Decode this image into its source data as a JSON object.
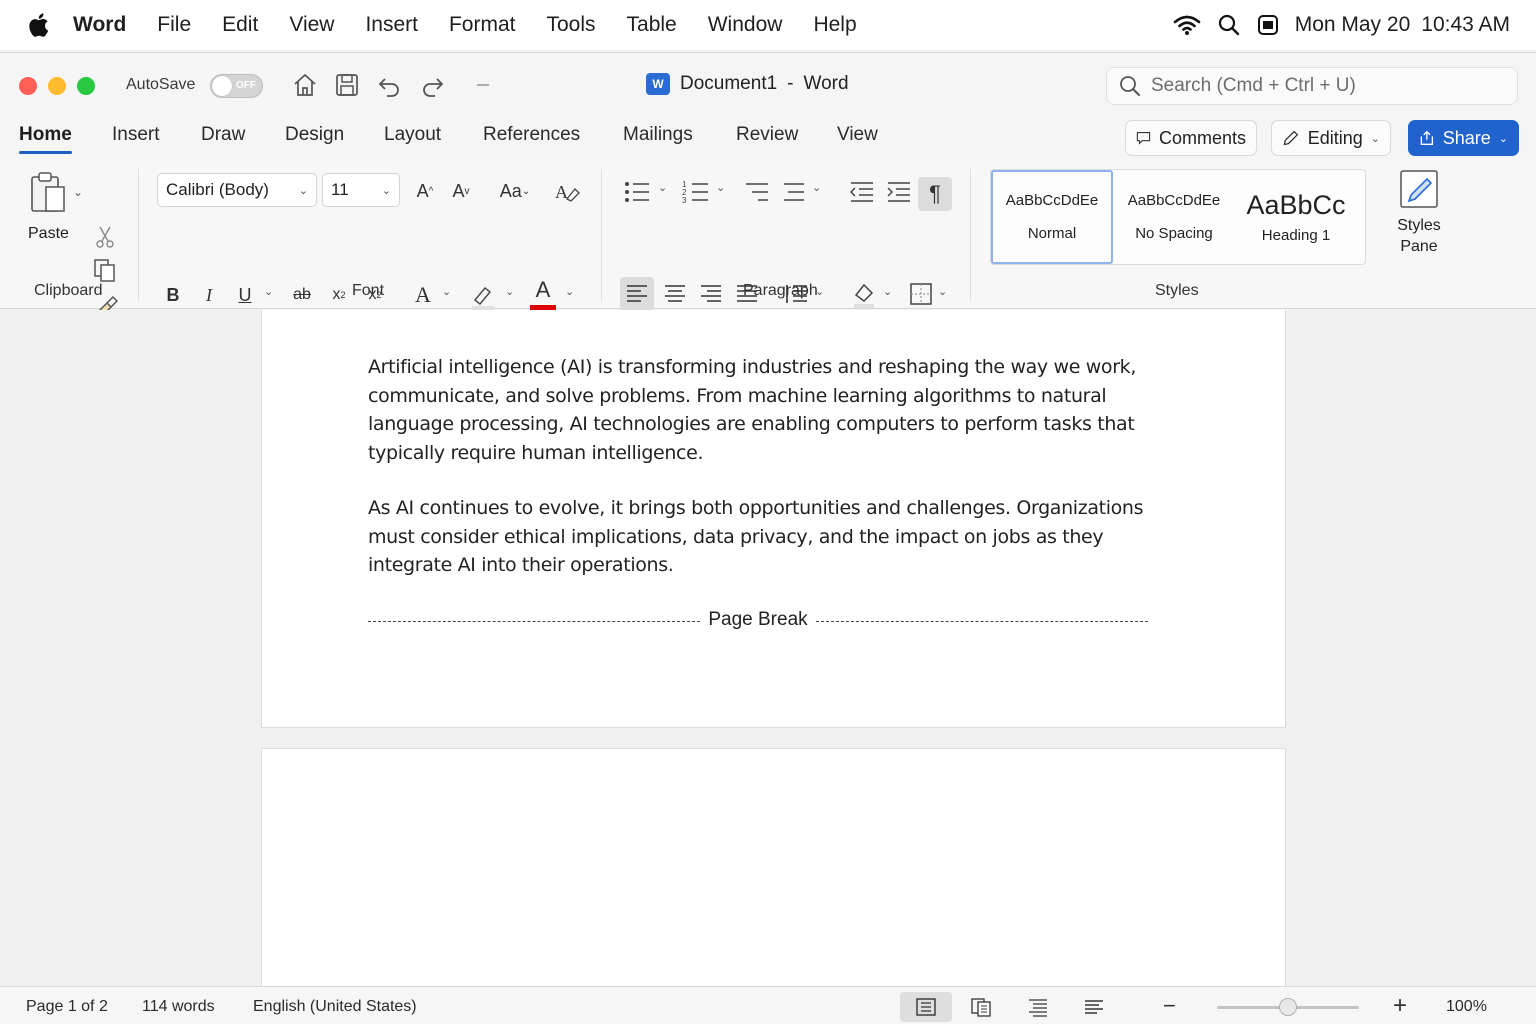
{
  "menubar": {
    "app": "Word",
    "items": [
      "File",
      "Edit",
      "View",
      "Insert",
      "Format",
      "Tools",
      "Table",
      "Window",
      "Help"
    ],
    "date": "Mon May 20",
    "time": "10:43 AM"
  },
  "titlebar": {
    "autosave_label": "AutoSave",
    "autosave_state": "OFF",
    "doc_name": "Document1",
    "separator": "-",
    "app_name": "Word",
    "app_badge": "W",
    "search_placeholder": "Search (Cmd + Ctrl + U)"
  },
  "tabs": {
    "items": [
      "Home",
      "Insert",
      "Draw",
      "Design",
      "Layout",
      "References",
      "Mailings",
      "Review",
      "View"
    ],
    "active": "Home",
    "comments": "Comments",
    "editing": "Editing",
    "share": "Share"
  },
  "ribbon": {
    "clipboard": {
      "paste": "Paste",
      "label": "Clipboard"
    },
    "font": {
      "name": "Calibri (Body)",
      "size": "11",
      "label": "Font",
      "font_color": "#e00000"
    },
    "paragraph": {
      "label": "Paragraph"
    },
    "styles": {
      "label": "Styles",
      "items": [
        {
          "sample": "AaBbCcDdEe",
          "name": "Normal"
        },
        {
          "sample": "AaBbCcDdEe",
          "name": "No Spacing"
        },
        {
          "sample": "AaBbCc",
          "name": "Heading 1"
        }
      ],
      "pane_line1": "Styles",
      "pane_line2": "Pane"
    }
  },
  "document": {
    "paragraphs": [
      "Artificial intelligence (AI) is transforming industries and reshaping the way we work, communicate, and solve problems. From machine learning algorithms to natural language processing, AI technologies are enabling computers to perform tasks that typically require human intelligence.",
      "As AI continues to evolve, it brings both opportunities and challenges. Organizations must consider ethical implications, data privacy, and the impact on jobs as they integrate AI into their operations."
    ],
    "page_break": "Page Break"
  },
  "statusbar": {
    "page": "Page 1 of 2",
    "words": "114 words",
    "language": "English (United States)",
    "zoom": "100%",
    "zoom_fraction": 0.5
  },
  "colors": {
    "accent": "#1f5fc4",
    "share": "#2063cc",
    "close": "#ff5f57",
    "minimize": "#febc2e",
    "maximize": "#28c840"
  }
}
